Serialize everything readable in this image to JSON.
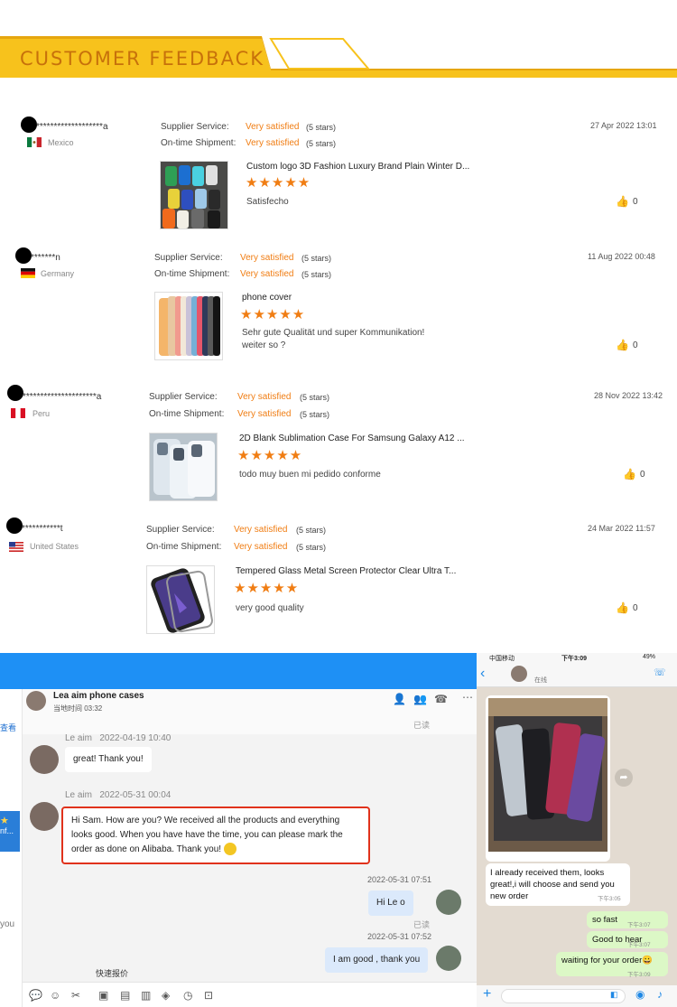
{
  "banner": {
    "title": "CUSTOMER FEEDBACK"
  },
  "review_labels": {
    "supplier": "Supplier Service:",
    "shipment": "On-time Shipment:",
    "stars_text": "(5 stars)",
    "stars": "★★★★★"
  },
  "reviews": [
    {
      "user": "*******************a",
      "country": "Mexico",
      "supplier_rating": "Very satisfied",
      "shipment_rating": "Very satisfied",
      "date": "27 Apr 2022 13:01",
      "product": "Custom logo 3D Fashion Luxury Brand Plain Winter D...",
      "comment": "Satisfecho",
      "likes": "0"
    },
    {
      "user": "*******n",
      "country": "Germany",
      "supplier_rating": "Very satisfied",
      "shipment_rating": "Very satisfied",
      "date": "11 Aug 2022 00:48",
      "product": "phone cover",
      "comment": "Sehr gute Qualität und super Kommunikation! weiter so ?",
      "likes": "0"
    },
    {
      "user": "*********************a",
      "country": "Peru",
      "supplier_rating": "Very satisfied",
      "shipment_rating": "Very satisfied",
      "date": "28 Nov 2022 13:42",
      "product": "2D Blank Sublimation Case For Samsung Galaxy A12 ...",
      "comment": "todo muy buen mi pedido conforme",
      "likes": "0"
    },
    {
      "user": "***********t",
      "country": "United States",
      "supplier_rating": "Very satisfied",
      "shipment_rating": "Very satisfied",
      "date": "24 Mar 2022 11:57",
      "product": "Tempered Glass Metal Screen Protector Clear Ultra T...",
      "comment": "very good quality",
      "likes": "0"
    }
  ],
  "chat": {
    "title": "Lea        aim phone cases",
    "local_time": "当地时间 03:32",
    "side_text_1": "查看",
    "side_text_2": "nf...",
    "side_text_3": "you",
    "messages": [
      {
        "sender": "Le          aim",
        "time": "2022-04-19 10:40",
        "text": "great! Thank you!"
      },
      {
        "sender": "Le          aim",
        "time": "2022-05-31 00:04",
        "text": "Hi Sam. How are you? We received all the products and everything looks good. When you have have the time, you can please mark the order as done on Alibaba. Thank you!"
      }
    ],
    "my_messages": [
      {
        "time": "2022-05-31 07:51",
        "text": "Hi Le         o"
      },
      {
        "time": "2022-05-31 07:52",
        "text": "I am good , thank you"
      }
    ],
    "read_label": "已读",
    "quick_quote": "快速报价"
  },
  "whatsapp": {
    "carrier": "中国移动",
    "clock": "下午3:09",
    "battery": "49%",
    "contact_status": "在线",
    "photo_time": "下午3:05",
    "incoming": {
      "text": "I already received them, looks great!,i will choose and send you new order",
      "time": "下午3:05"
    },
    "outgoing": [
      {
        "text": "so fast",
        "time": "下午3:07"
      },
      {
        "text": "Good to hear",
        "time": "下午3:07"
      },
      {
        "text": "waiting for your order😀",
        "time": "下午3:09"
      }
    ]
  },
  "colors": {
    "accent_orange": "#f07d13",
    "banner_yellow": "#f7c21c",
    "alibaba_blue": "#1e90f5",
    "highlight_red": "#e0321c"
  }
}
